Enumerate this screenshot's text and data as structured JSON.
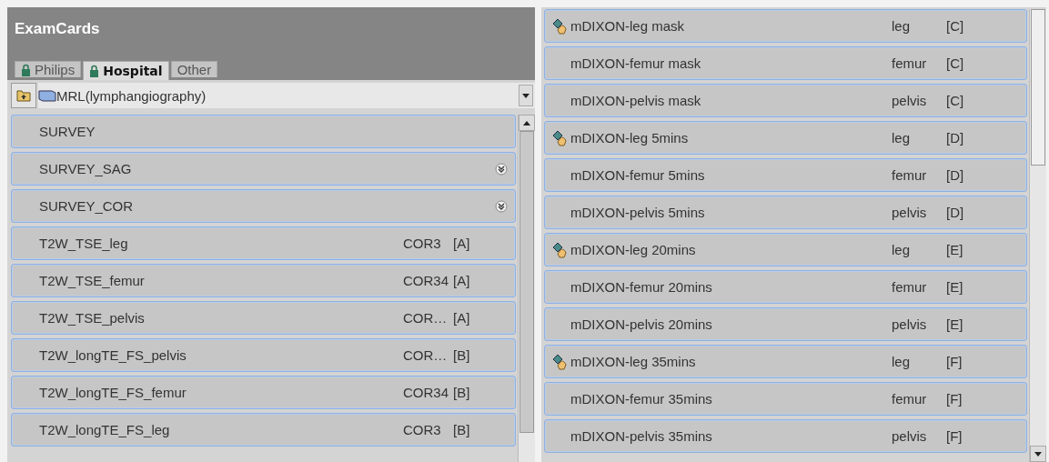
{
  "panel": {
    "title": "ExamCards"
  },
  "tabs": [
    {
      "label": "Philips",
      "locked": true,
      "selected": false
    },
    {
      "label": "Hospital",
      "locked": true,
      "selected": true
    },
    {
      "label": "Other",
      "locked": false,
      "selected": false
    }
  ],
  "exam_selector": {
    "value": "MRL(lymphangiography)"
  },
  "left_list": [
    {
      "name": "SURVEY",
      "expandable": false
    },
    {
      "name": "SURVEY_SAG",
      "expandable": true
    },
    {
      "name": "SURVEY_COR",
      "expandable": true
    },
    {
      "name": "T2W_TSE_leg",
      "column_2": "COR3",
      "column_3": "[A]",
      "expandable": false
    },
    {
      "name": "T2W_TSE_femur",
      "column_2": "COR34",
      "column_3": "[A]",
      "expandable": false
    },
    {
      "name": "T2W_TSE_pelvis",
      "column_2": "COR…",
      "column_3": "[A]",
      "expandable": false
    },
    {
      "name": "T2W_longTE_FS_pelvis",
      "column_2": "COR…",
      "column_3": "[B]",
      "expandable": false
    },
    {
      "name": "T2W_longTE_FS_femur",
      "column_2": "COR34",
      "column_3": "[B]",
      "expandable": false
    },
    {
      "name": "T2W_longTE_FS_leg",
      "column_2": "COR3",
      "column_3": "[B]",
      "expandable": false
    }
  ],
  "right_list": [
    {
      "name": "mDIXON-leg mask",
      "column_2": "leg",
      "column_3": "[C]",
      "icon": true
    },
    {
      "name": "mDIXON-femur mask",
      "column_2": "femur",
      "column_3": "[C]",
      "icon": false
    },
    {
      "name": "mDIXON-pelvis mask",
      "column_2": "pelvis",
      "column_3": "[C]",
      "icon": false
    },
    {
      "name": "mDIXON-leg 5mins",
      "column_2": "leg",
      "column_3": "[D]",
      "icon": true
    },
    {
      "name": "mDIXON-femur 5mins",
      "column_2": "femur",
      "column_3": "[D]",
      "icon": false
    },
    {
      "name": "mDIXON-pelvis 5mins",
      "column_2": "pelvis",
      "column_3": "[D]",
      "icon": false
    },
    {
      "name": "mDIXON-leg 20mins",
      "column_2": "leg",
      "column_3": "[E]",
      "icon": true
    },
    {
      "name": "mDIXON-femur 20mins",
      "column_2": "femur",
      "column_3": "[E]",
      "icon": false
    },
    {
      "name": "mDIXON-pelvis 20mins",
      "column_2": "pelvis",
      "column_3": "[E]",
      "icon": false
    },
    {
      "name": "mDIXON-leg 35mins",
      "column_2": "leg",
      "column_3": "[F]",
      "icon": true
    },
    {
      "name": "mDIXON-femur 35mins",
      "column_2": "femur",
      "column_3": "[F]",
      "icon": false
    },
    {
      "name": "mDIXON-pelvis 35mins",
      "column_2": "pelvis",
      "column_3": "[F]",
      "icon": false
    }
  ]
}
